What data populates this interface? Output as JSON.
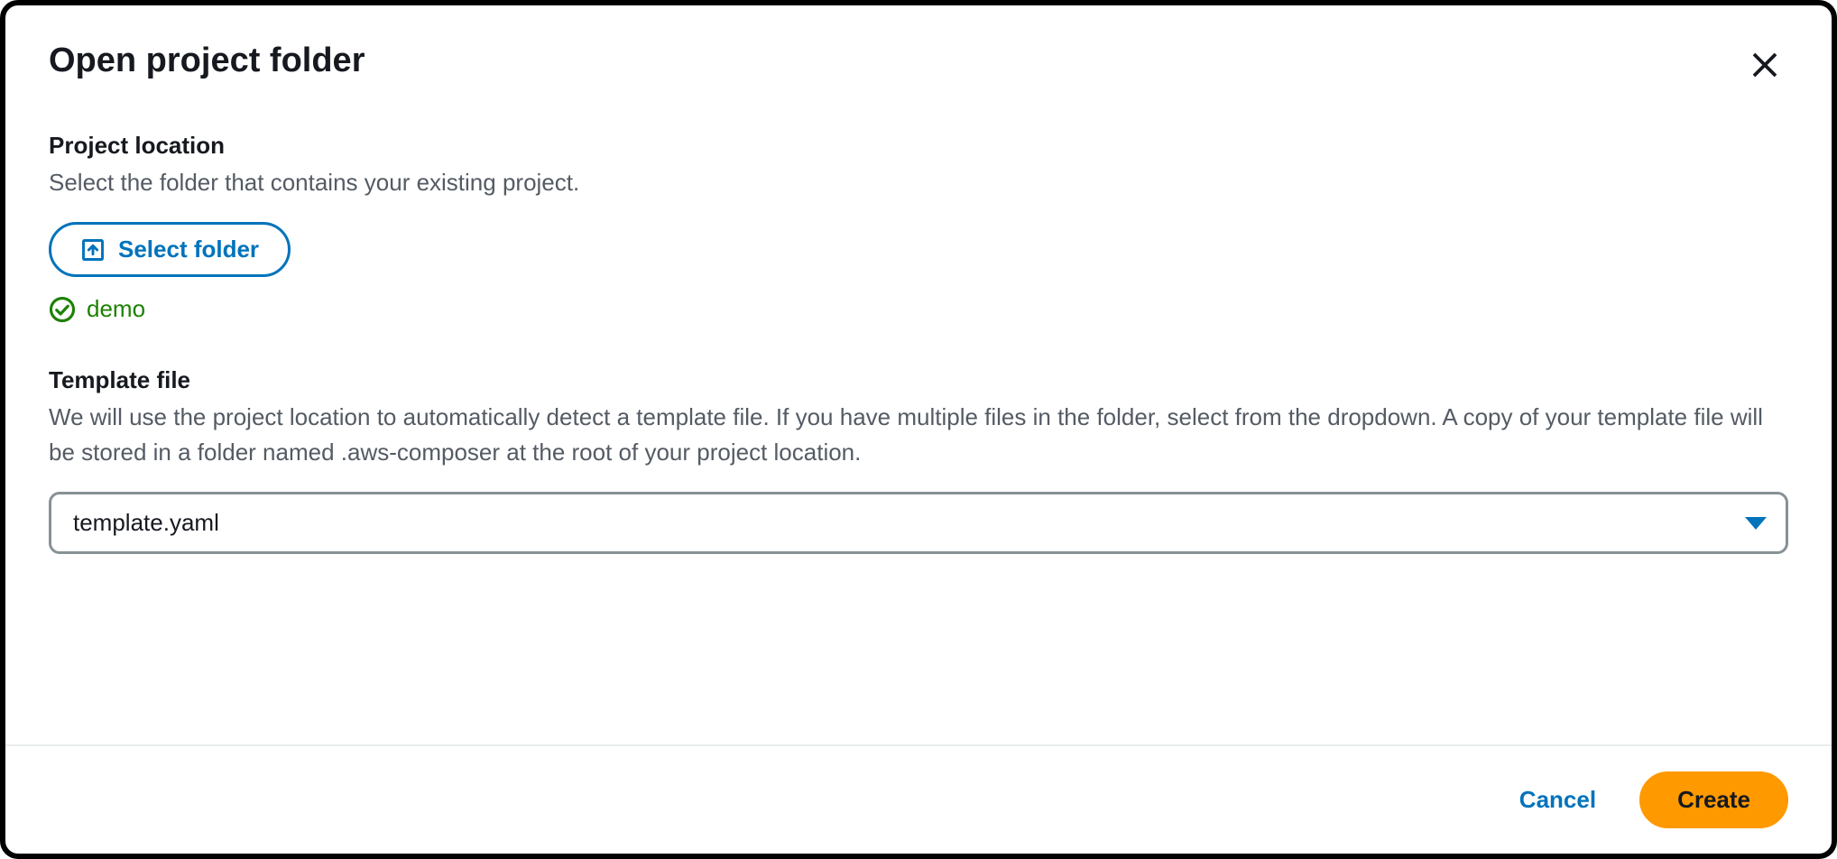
{
  "dialog": {
    "title": "Open project folder",
    "projectLocation": {
      "heading": "Project location",
      "description": "Select the folder that contains your existing project.",
      "selectButtonLabel": "Select folder",
      "selectedFolderName": "demo"
    },
    "templateFile": {
      "heading": "Template file",
      "description": "We will use the project location to automatically detect a template file. If you have multiple files in the folder, select from the dropdown. A copy of your template file will be stored in a folder named .aws-composer at the root of your project location.",
      "selectedValue": "template.yaml"
    },
    "footer": {
      "cancelLabel": "Cancel",
      "createLabel": "Create"
    }
  }
}
